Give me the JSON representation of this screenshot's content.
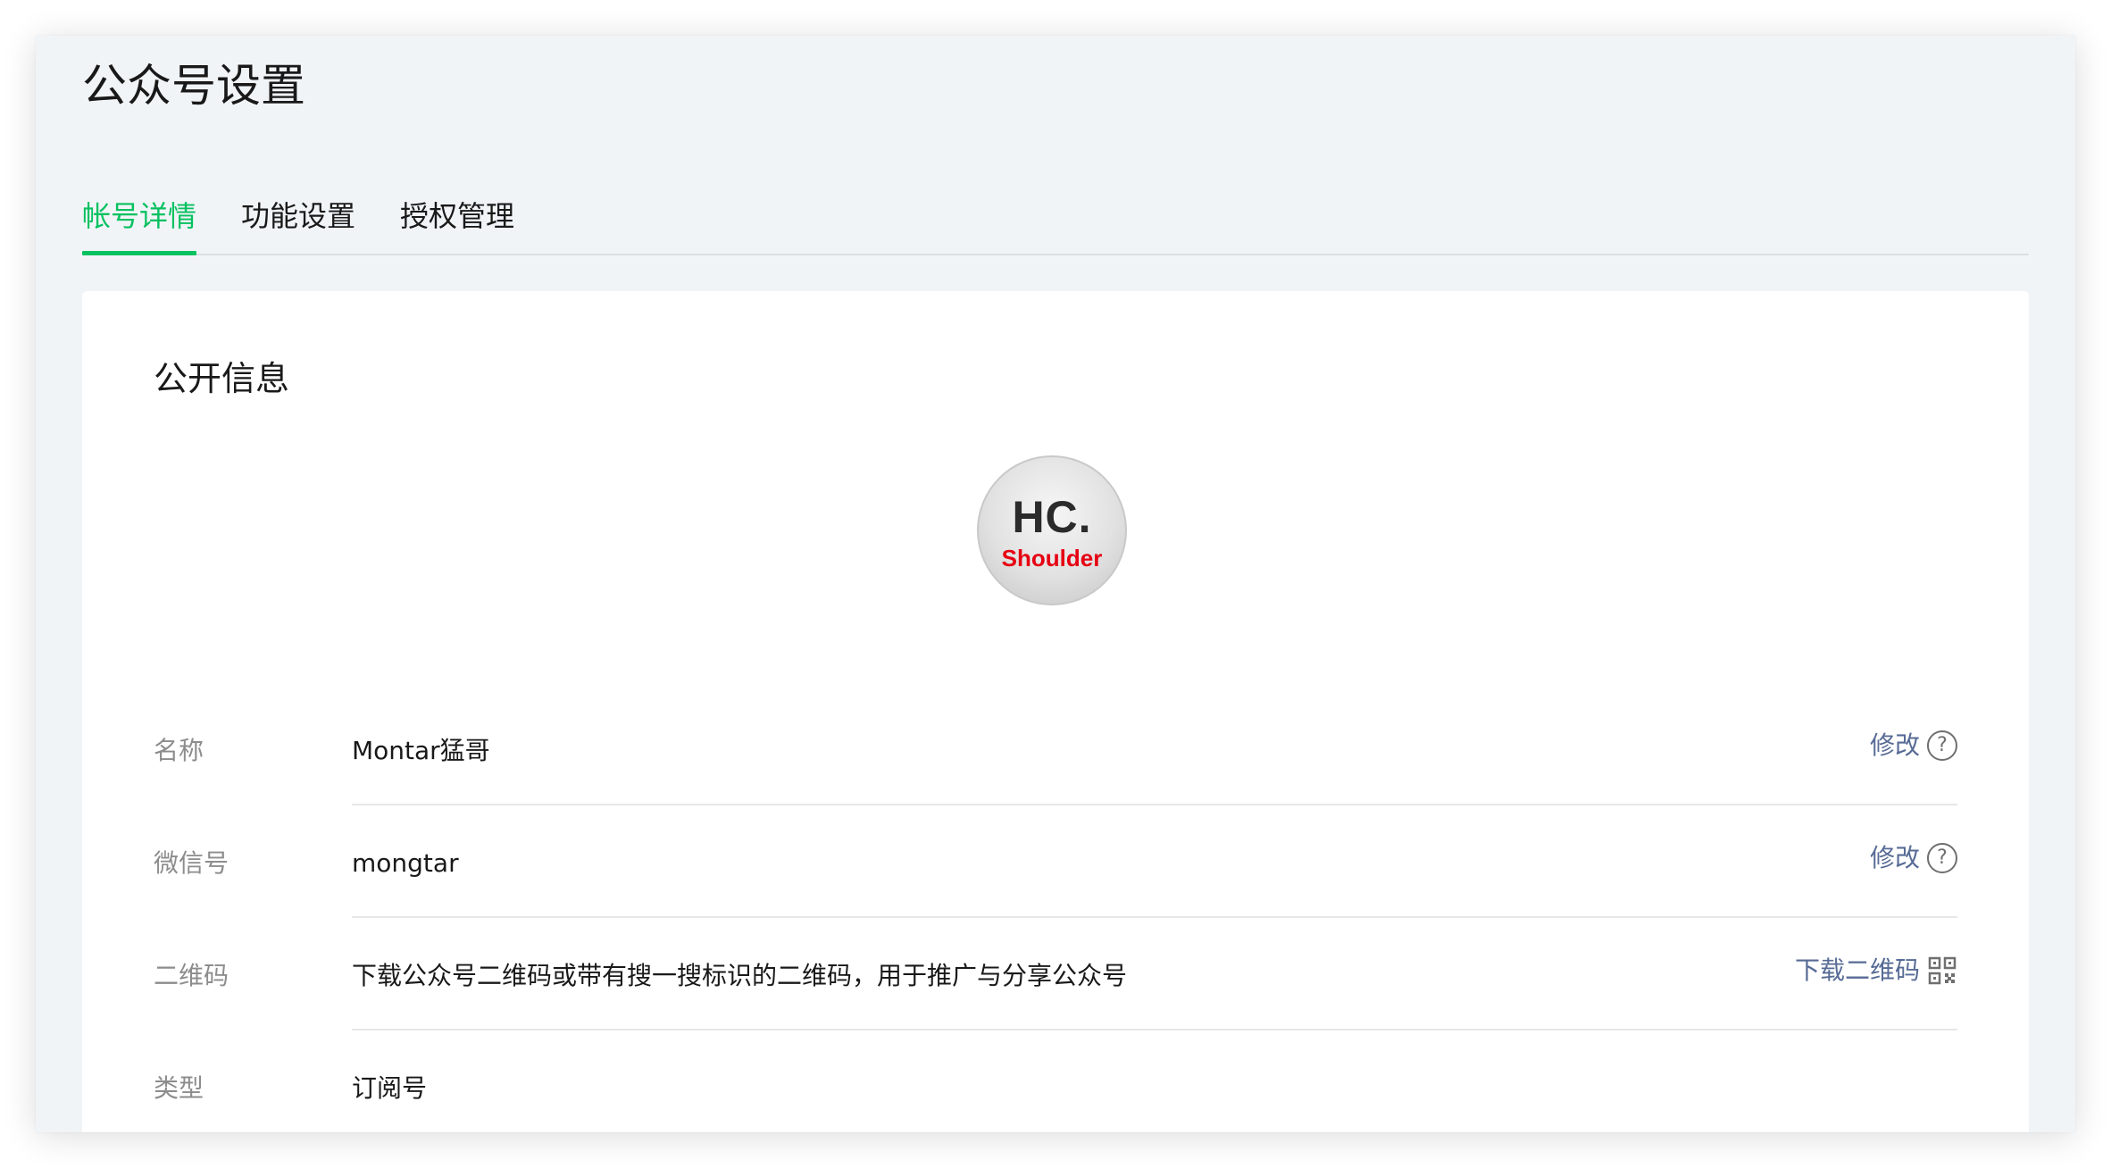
{
  "page": {
    "title": "公众号设置"
  },
  "tabs": [
    {
      "label": "帐号详情",
      "active": true
    },
    {
      "label": "功能设置",
      "active": false
    },
    {
      "label": "授权管理",
      "active": false
    }
  ],
  "public_info": {
    "title": "公开信息",
    "avatar": {
      "logo_main": "HC.",
      "logo_sub": "Shoulder"
    },
    "rows": [
      {
        "label": "名称",
        "value": "Montar猛哥",
        "action": "修改",
        "action_icon": "help-icon"
      },
      {
        "label": "微信号",
        "value": "mongtar",
        "action": "修改",
        "action_icon": "help-icon"
      },
      {
        "label": "二维码",
        "value": "下载公众号二维码或带有搜一搜标识的二维码，用于推广与分享公众号",
        "action": "下载二维码",
        "action_icon": "qr-code-icon"
      },
      {
        "label": "类型",
        "value": "订阅号"
      }
    ]
  },
  "colors": {
    "accent": "#07c160",
    "link": "#576b95",
    "label": "#8c8c8c",
    "background": "#f1f4f7"
  }
}
